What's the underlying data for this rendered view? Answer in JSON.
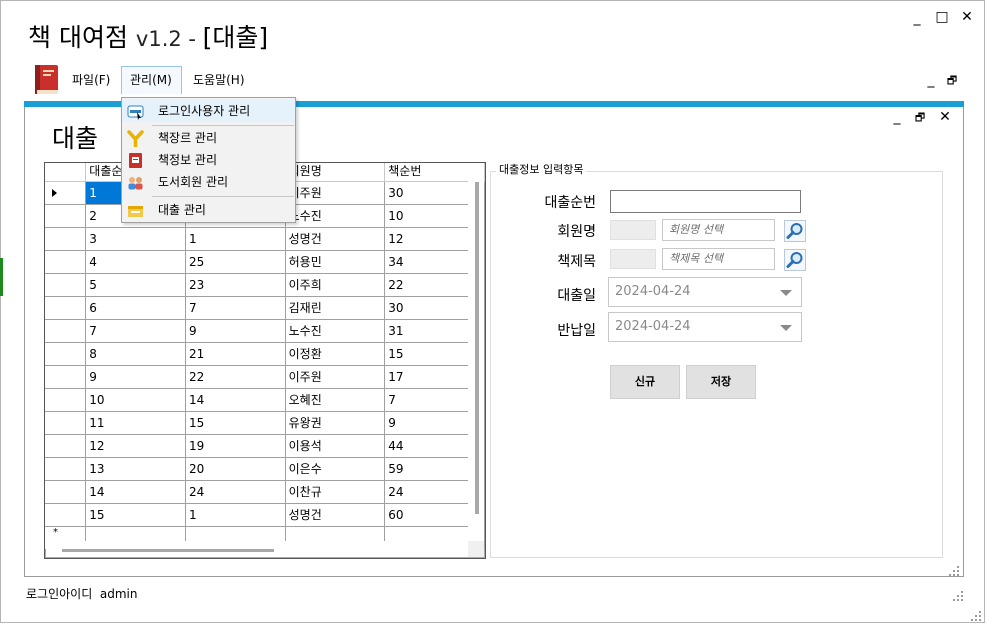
{
  "window": {
    "title_main": "책 대여점",
    "title_version": "v1.2 - ",
    "title_child": "[대출]",
    "controls": {
      "minimize": "_",
      "maximize": "□",
      "close": "✕"
    }
  },
  "menubar": {
    "items": [
      {
        "label": "파일(F)"
      },
      {
        "label": "관리(M)"
      },
      {
        "label": "도움말(H)"
      }
    ],
    "mdi_controls": {
      "minimize": "_",
      "restore": "🗗"
    }
  },
  "child": {
    "title": "대출",
    "controls": {
      "minimize": "_",
      "restore": "🗗",
      "close": "✕"
    }
  },
  "management_menu": {
    "items": [
      {
        "label": "로그인사용자 관리",
        "icon": "login-icon"
      },
      {
        "label": "책장르 관리",
        "icon": "genre-icon"
      },
      {
        "label": "책정보 관리",
        "icon": "book-info-icon"
      },
      {
        "label": "도서회원 관리",
        "icon": "members-icon"
      },
      {
        "label": "대출 관리",
        "icon": "rent-icon"
      }
    ]
  },
  "grid": {
    "columns": [
      "대출순번",
      "",
      "회원명",
      "책순번"
    ],
    "rows": [
      [
        "1",
        "",
        "이주원",
        "30"
      ],
      [
        "2",
        "",
        "노수진",
        "10"
      ],
      [
        "3",
        "1",
        "성명건",
        "12"
      ],
      [
        "4",
        "25",
        "허용민",
        "34"
      ],
      [
        "5",
        "23",
        "이주희",
        "22"
      ],
      [
        "6",
        "7",
        "김재린",
        "30"
      ],
      [
        "7",
        "9",
        "노수진",
        "31"
      ],
      [
        "8",
        "21",
        "이정환",
        "15"
      ],
      [
        "9",
        "22",
        "이주원",
        "17"
      ],
      [
        "10",
        "14",
        "오혜진",
        "7"
      ],
      [
        "11",
        "15",
        "유왕권",
        "9"
      ],
      [
        "12",
        "19",
        "이용석",
        "44"
      ],
      [
        "13",
        "20",
        "이은수",
        "59"
      ],
      [
        "14",
        "24",
        "이찬규",
        "24"
      ],
      [
        "15",
        "1",
        "성명건",
        "60"
      ]
    ],
    "new_row_marker": "*"
  },
  "form": {
    "legend": "대출정보 입력항목",
    "rent_no_label": "대출순번",
    "rent_no_value": "",
    "member_label": "회원명",
    "member_placeholder": "회원명 선택",
    "book_label": "책제목",
    "book_placeholder": "책제목 선택",
    "rent_date_label": "대출일",
    "rent_date_value": "2024-04-24",
    "return_date_label": "반납일",
    "return_date_value": "2024-04-24",
    "new_button": "신규",
    "save_button": "저장"
  },
  "status": {
    "login_label": "로그인아이디",
    "login_value": "admin"
  },
  "colors": {
    "accent_bar": "#1a9fd4",
    "selection": "#0078d7",
    "side_accent": "#1e8a1e"
  }
}
